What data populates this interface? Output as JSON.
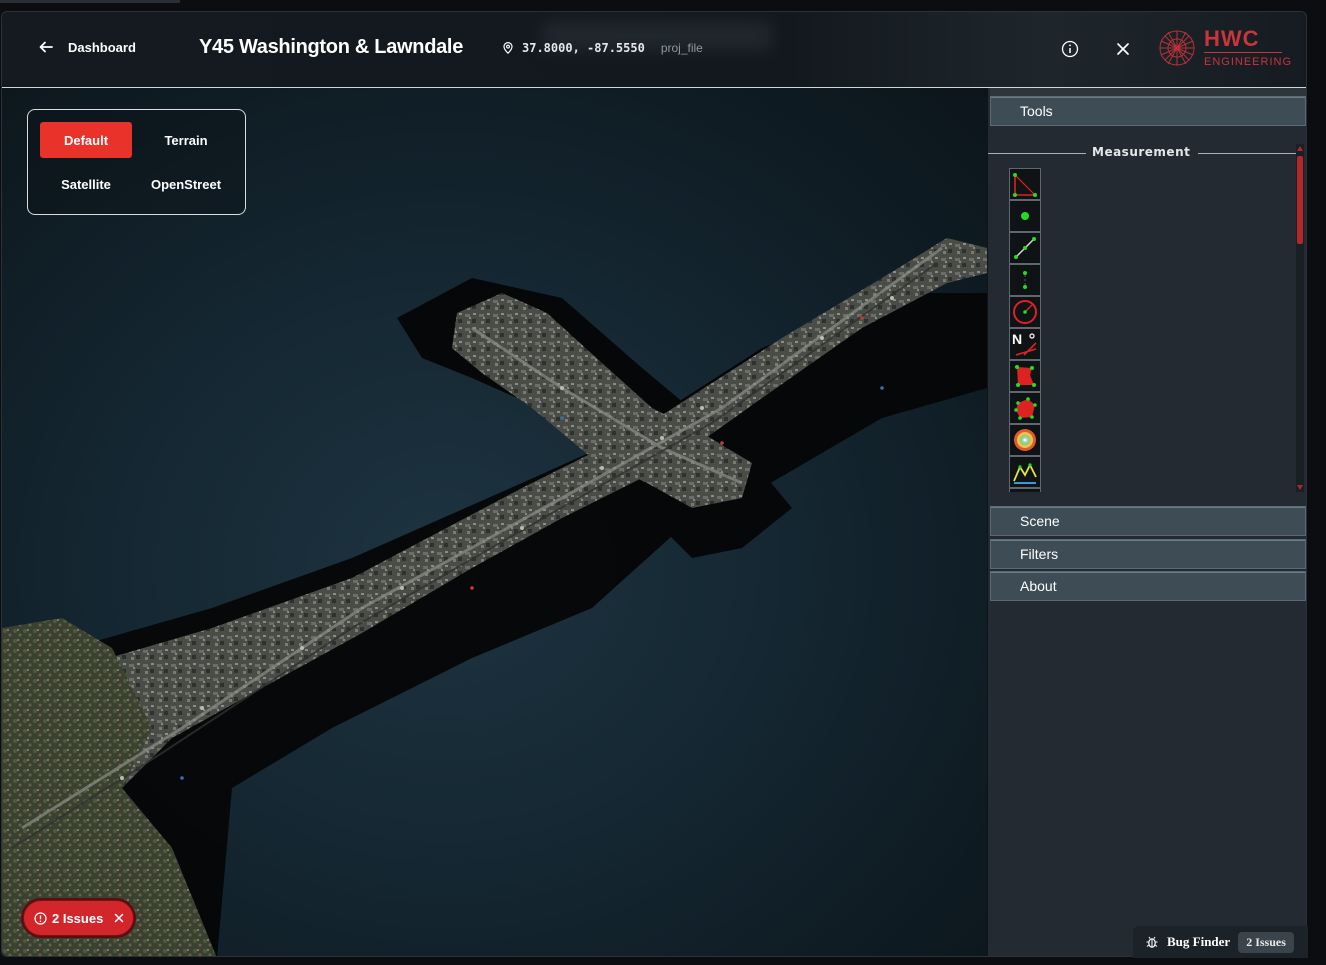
{
  "header": {
    "back_label": "Dashboard",
    "title": "Y45 Washington & Lawndale",
    "coordinates": "37.8000, -87.5550",
    "file_label": "proj_file",
    "logo_primary": "HWC",
    "logo_secondary": "ENGINEERING"
  },
  "basemap": {
    "options": [
      "Default",
      "Terrain",
      "Satellite",
      "OpenStreet"
    ],
    "selected": "Default",
    "accent_color": "#e8322a"
  },
  "sidebar": {
    "sections": [
      "Tools",
      "Scene",
      "Filters",
      "About"
    ],
    "tools_group_label": "Measurement",
    "tool_icons": [
      "angle-measure-icon",
      "point-measure-icon",
      "distance-measure-icon",
      "height-measure-icon",
      "circle-measure-icon",
      "azimuth-measure-icon",
      "area-measure-icon",
      "volume-measure-icon",
      "sphere-volume-icon",
      "profile-icon"
    ]
  },
  "issues": {
    "pill_label": "2 Issues",
    "color": "#d3262b"
  },
  "bug_finder": {
    "label": "Bug Finder",
    "badge": "2 Issues"
  }
}
